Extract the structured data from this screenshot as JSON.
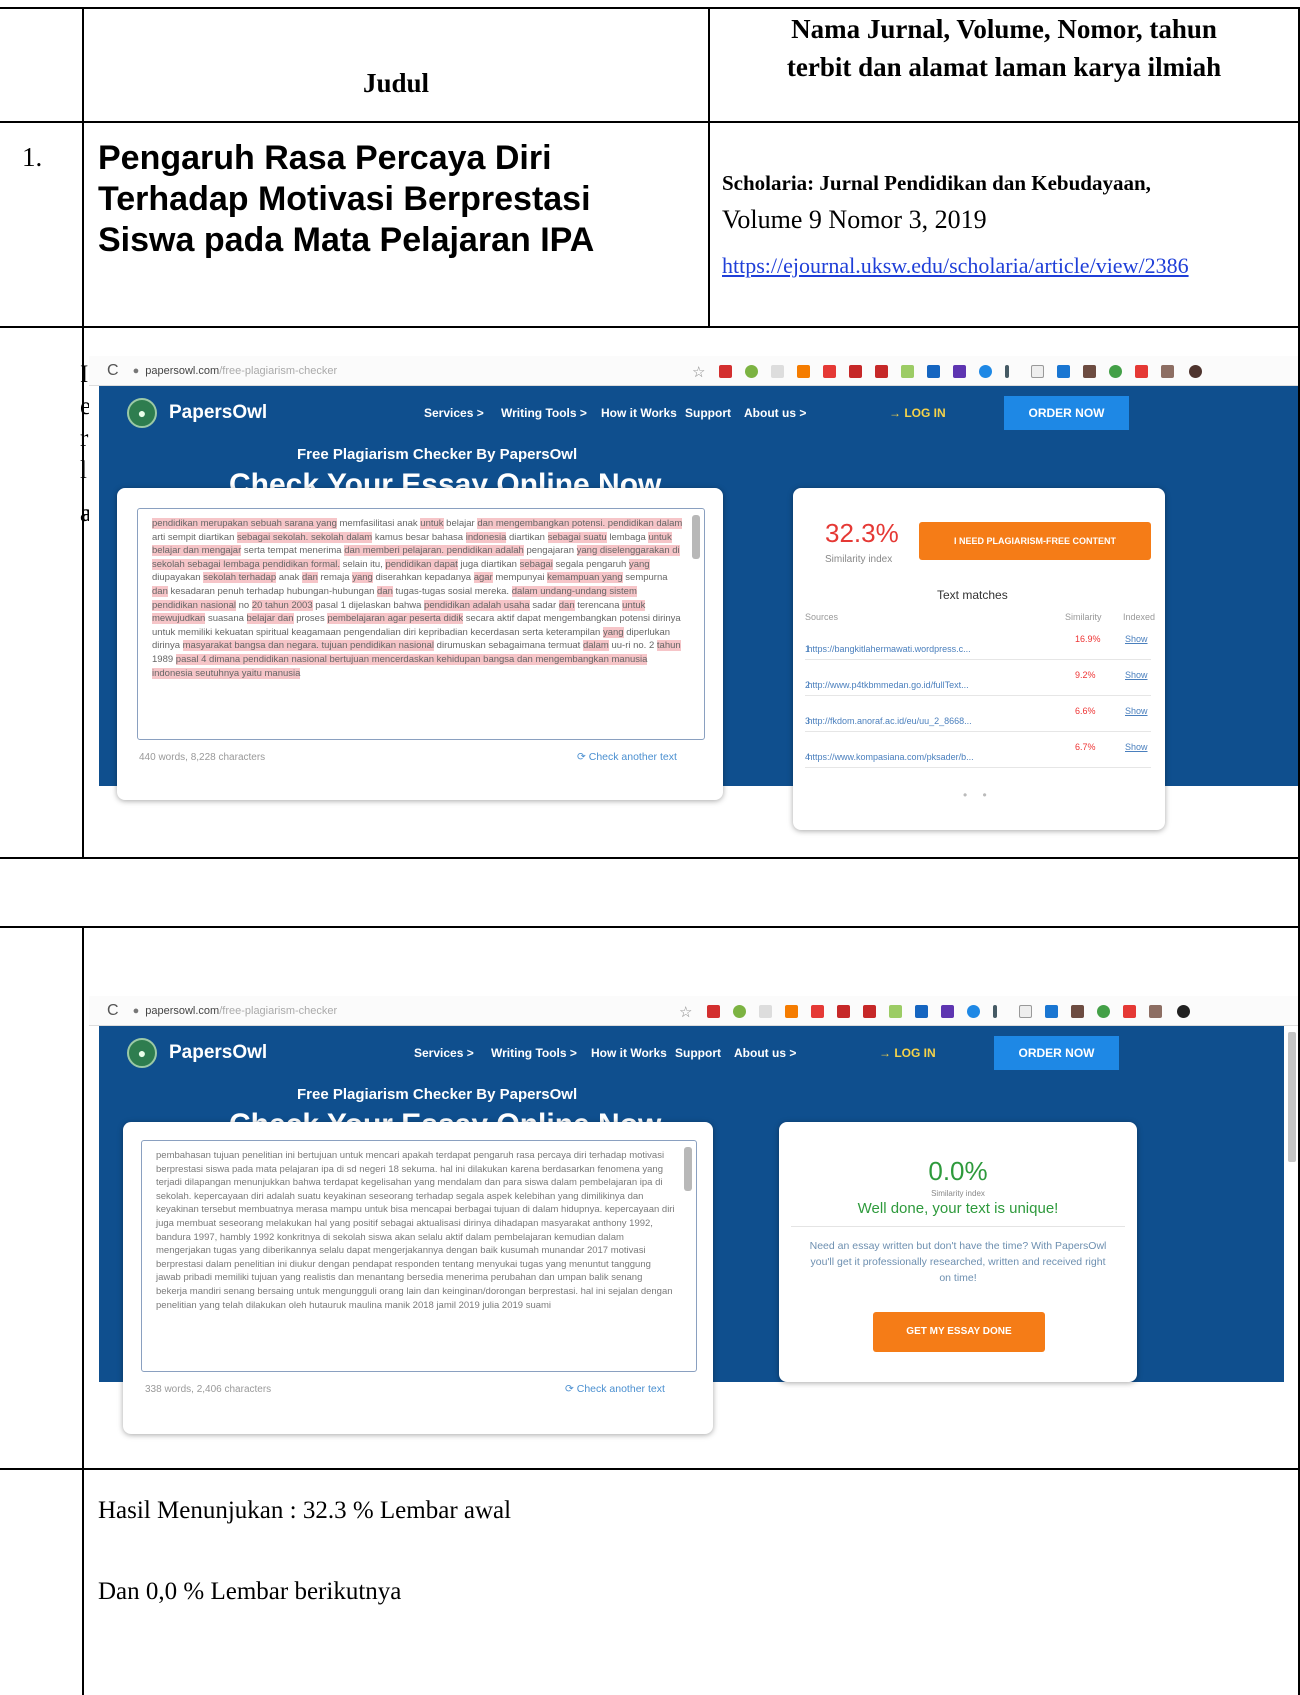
{
  "table": {
    "header": {
      "judul": "Judul",
      "journal_line1": "Nama Jurnal, Volume, Nomor, tahun",
      "journal_line2": "terbit dan alamat laman karya ilmiah"
    },
    "row1": {
      "number": "1.",
      "title": "Pengaruh Rasa Percaya Diri Terhadap Motivasi Berprestasi Siswa pada Mata Pelajaran IPA",
      "journal_name": "Scholaria: Jurnal Pendidikan dan Kebudayaan,",
      "volume": "Volume 9 Nomor 3, 2019",
      "link": "https://ejournal.uksw.edu/scholaria/article/view/2386"
    },
    "left_overflow_chars": [
      "I",
      "e",
      "r",
      "l",
      "a"
    ],
    "result_line1": "Hasil Menunjukan : 32.3 % Lembar awal",
    "result_line2": "Dan 0,0 % Lembar berikutnya"
  },
  "screenshot1": {
    "url_host": "papersowl.com",
    "url_path": "/free-plagiarism-checker",
    "brand": "PapersOwl",
    "nav": [
      "Services >",
      "Writing Tools >",
      "How it Works",
      "Support",
      "About us >"
    ],
    "login": "LOG IN",
    "order": "ORDER NOW",
    "subtitle": "Free Plagiarism Checker By PapersOwl",
    "heading": "Check Your Essay Online Now",
    "essay_text": [
      {
        "t": "pendidikan merupakan sebuah sarana yang",
        "h": true
      },
      {
        "t": " memfasilitasi anak ",
        "h": false
      },
      {
        "t": "untuk",
        "h": true
      },
      {
        "t": " belajar ",
        "h": false
      },
      {
        "t": "dan mengembangkan potensi. pendidikan dalam",
        "h": true
      },
      {
        "t": " arti sempit diartikan ",
        "h": false
      },
      {
        "t": "sebagai sekolah. sekolah dalam",
        "h": true
      },
      {
        "t": " kamus besar bahasa ",
        "h": false
      },
      {
        "t": "indonesia",
        "h": true
      },
      {
        "t": " diartikan ",
        "h": false
      },
      {
        "t": "sebagai suatu",
        "h": true
      },
      {
        "t": " lembaga ",
        "h": false
      },
      {
        "t": "untuk belajar dan mengajar",
        "h": true
      },
      {
        "t": " serta tempat menerima ",
        "h": false
      },
      {
        "t": "dan memberi pelajaran. pendidikan adalah",
        "h": true
      },
      {
        "t": " pengajaran ",
        "h": false
      },
      {
        "t": "yang diselenggarakan di sekolah sebagai lembaga pendidikan formal.",
        "h": true
      },
      {
        "t": " selain itu, ",
        "h": false
      },
      {
        "t": "pendidikan dapat",
        "h": true
      },
      {
        "t": " juga diartikan ",
        "h": false
      },
      {
        "t": "sebagai",
        "h": true
      },
      {
        "t": " segala pengaruh ",
        "h": false
      },
      {
        "t": "yang",
        "h": true
      },
      {
        "t": " diupayakan ",
        "h": false
      },
      {
        "t": "sekolah terhadap",
        "h": true
      },
      {
        "t": " anak ",
        "h": false
      },
      {
        "t": "dan",
        "h": true
      },
      {
        "t": " remaja ",
        "h": false
      },
      {
        "t": "yang",
        "h": true
      },
      {
        "t": " diserahkan kepadanya ",
        "h": false
      },
      {
        "t": "agar",
        "h": true
      },
      {
        "t": " mempunyai ",
        "h": false
      },
      {
        "t": "kemampuan yang",
        "h": true
      },
      {
        "t": " sempurna ",
        "h": false
      },
      {
        "t": "dan",
        "h": true
      },
      {
        "t": " kesadaran penuh terhadap hubungan-hubungan ",
        "h": false
      },
      {
        "t": "dan",
        "h": true
      },
      {
        "t": " tugas-tugas sosial mereka. ",
        "h": false
      },
      {
        "t": "dalam undang-undang sistem pendidikan nasional",
        "h": true
      },
      {
        "t": " no ",
        "h": false
      },
      {
        "t": "20 tahun 2003",
        "h": true
      },
      {
        "t": " pasal 1 dijelaskan bahwa ",
        "h": false
      },
      {
        "t": "pendidikan adalah usaha",
        "h": true
      },
      {
        "t": " sadar ",
        "h": false
      },
      {
        "t": "dan",
        "h": true
      },
      {
        "t": " terencana ",
        "h": false
      },
      {
        "t": "untuk mewujudkan",
        "h": true
      },
      {
        "t": " suasana ",
        "h": false
      },
      {
        "t": "belajar dan",
        "h": true
      },
      {
        "t": " proses ",
        "h": false
      },
      {
        "t": "pembelajaran agar peserta didik",
        "h": true
      },
      {
        "t": " secara aktif dapat mengembangkan potensi dirinya untuk memiliki kekuatan spiritual keagamaan pengendalian diri kepribadian kecerdasan serta keterampilan ",
        "h": false
      },
      {
        "t": "yang",
        "h": true
      },
      {
        "t": " diperlukan dirinya ",
        "h": false
      },
      {
        "t": "masyarakat bangsa dan negara. tujuan pendidikan nasional",
        "h": true
      },
      {
        "t": " dirumuskan sebagaimana termuat ",
        "h": false
      },
      {
        "t": "dalam",
        "h": true
      },
      {
        "t": " uu-ri no. 2 ",
        "h": false
      },
      {
        "t": "tahun",
        "h": true
      },
      {
        "t": " 1989 ",
        "h": false
      },
      {
        "t": "pasal 4 dimana pendidikan nasional bertujuan mencerdaskan kehidupan bangsa dan mengembangkan manusia indonesia seutuhnya yaitu manusia",
        "h": true
      }
    ],
    "word_count": "440 words, 8,228 characters",
    "check_another": "Check another text",
    "percent": "32.3%",
    "similarity_index": "Similarity index",
    "need_button": "I NEED PLAGIARISM-FREE CONTENT",
    "text_matches": "Text matches",
    "col_sources": "Sources",
    "col_similarity": "Similarity",
    "col_indexed": "Indexed",
    "matches": [
      {
        "n": "1",
        "url": "https://bangkitlahermawati.wordpress.c...",
        "sim": "16.9%",
        "action": "Show"
      },
      {
        "n": "2",
        "url": "http://www.p4tkbmmedan.go.id/fullText...",
        "sim": "9.2%",
        "action": "Show"
      },
      {
        "n": "3",
        "url": "http://fkdom.anoraf.ac.id/eu/uu_2_8668...",
        "sim": "6.6%",
        "action": "Show"
      },
      {
        "n": "4",
        "url": "https://www.kompasiana.com/pksader/b...",
        "sim": "6.7%",
        "action": "Show"
      }
    ],
    "pager": "• •"
  },
  "screenshot2": {
    "url_host": "papersowl.com",
    "url_path": "/free-plagiarism-checker",
    "brand": "PapersOwl",
    "nav": [
      "Services >",
      "Writing Tools >",
      "How it Works",
      "Support",
      "About us >"
    ],
    "login": "LOG IN",
    "order": "ORDER NOW",
    "subtitle": "Free Plagiarism Checker By PapersOwl",
    "heading": "Check Your Essay Online Now",
    "essay_text": "pembahasan tujuan penelitian ini bertujuan untuk mencari apakah terdapat pengaruh rasa percaya diri terhadap motivasi berprestasi siswa pada mata pelajaran ipa di sd negeri 18 sekuma. hal ini dilakukan karena berdasarkan fenomena yang terjadi dilapangan menunjukkan bahwa terdapat kegelisahan yang mendalam dan para siswa dalam pembelajaran ipa di sekolah. kepercayaan diri adalah suatu keyakinan seseorang terhadap segala aspek kelebihan yang dimilikinya dan keyakinan tersebut membuatnya merasa mampu untuk bisa mencapai berbagai tujuan di dalam hidupnya. kepercayaan diri juga membuat seseorang melakukan hal yang positif sebagai aktualisasi dirinya dihadapan masyarakat anthony 1992, bandura 1997, hambly 1992 konkritnya di sekolah siswa akan selalu aktif dalam pembelajaran kemudian dalam mengerjakan tugas yang diberikannya selalu dapat mengerjakannya dengan baik kusumah munandar 2017 motivasi berprestasi dalam penelitian ini diukur dengan pendapat responden tentang menyukai tugas yang menuntut tanggung jawab pribadi memiliki tujuan yang realistis dan menantang bersedia menerima perubahan dan umpan balik senang bekerja mandiri senang bersaing untuk mengungguli orang lain dan keinginan/dorongan berprestasi. hal ini sejalan dengan penelitian yang telah dilakukan oleh hutauruk maulina manik 2018 jamil 2019 julia 2019 suami",
    "word_count": "338 words, 2,406 characters",
    "check_another": "Check another text",
    "percent": "0.0%",
    "similarity_index": "Similarity index",
    "unique": "Well done, your text is unique!",
    "cta_text": "Need an essay written but don't have the time? With PapersOwl you'll get it professionally researched, written and received right on time!",
    "get_button": "GET MY ESSAY DONE"
  },
  "colors": {
    "hero_blue": "#0f4f8e",
    "order_blue": "#1e88e5",
    "orange": "#f57c17",
    "red_pct": "#e53935",
    "green_pct": "#2e9a3c",
    "highlight": "#f6c5c8",
    "link_blue": "#1f3fd8"
  },
  "icons": [
    "reload-icon",
    "lock-icon",
    "star-icon",
    "owl-logo-icon",
    "login-icon",
    "refresh-icon",
    "scrollbar"
  ]
}
